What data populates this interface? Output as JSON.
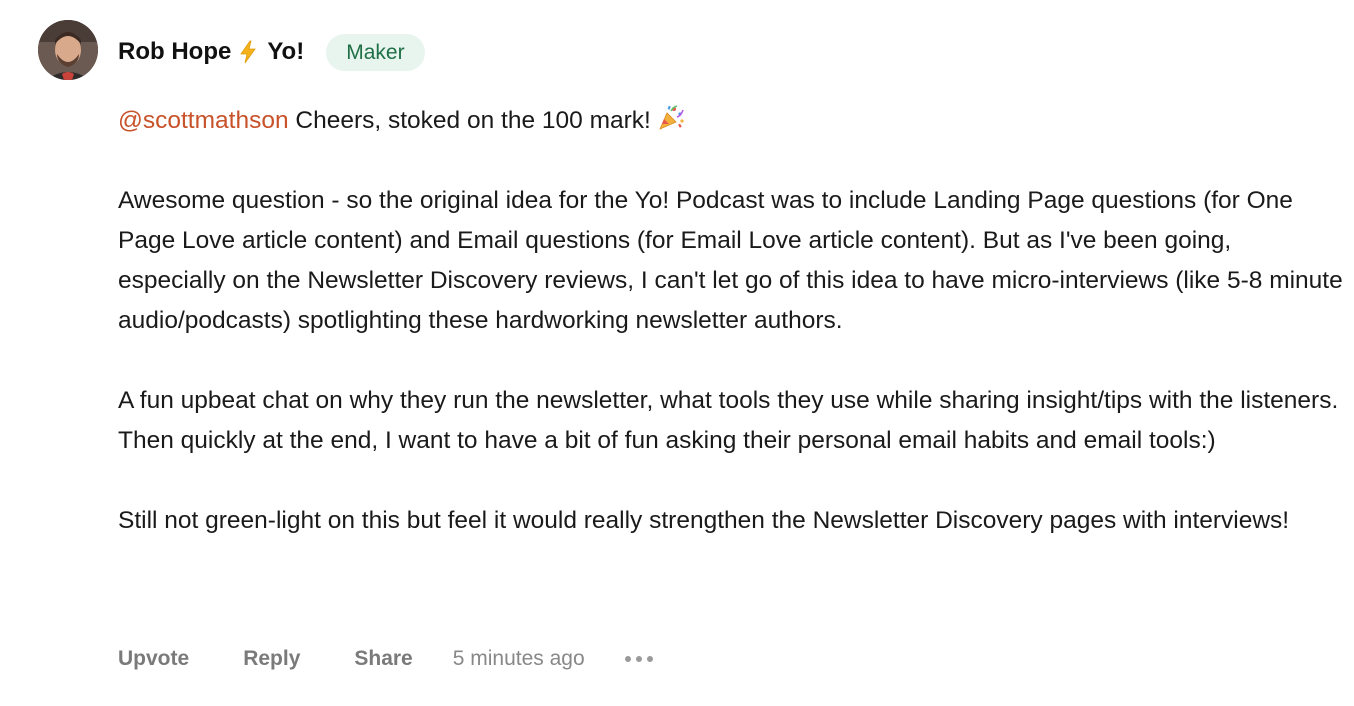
{
  "comment": {
    "author": {
      "name_part1": "Rob Hope",
      "bolt_icon": "lightning-bolt-icon",
      "name_part2": "Yo!",
      "badge": "Maker",
      "avatar_icon": "user-avatar"
    },
    "body": {
      "mention": "@scottmathson",
      "line1": " Cheers, stoked on the 100 mark!",
      "party_icon": "party-popper-icon",
      "paragraph2": "Awesome question - so the original idea for the Yo! Podcast was to include Landing Page questions (for One Page Love article content) and Email questions (for Email Love article content). But as I've been going, especially on the Newsletter Discovery reviews, I can't let go of this idea to have micro-interviews (like 5-8 minute audio/podcasts) spotlighting these hardworking newsletter authors.",
      "paragraph3": "A fun upbeat chat on why they run the newsletter, what tools they use while sharing insight/tips with the listeners. Then quickly at the end, I want to have a bit of fun asking their personal email habits and email tools:)",
      "paragraph4": "Still not green-light on this but feel it would really strengthen the Newsletter Discovery pages with interviews!"
    },
    "actions": {
      "upvote": "Upvote",
      "reply": "Reply",
      "share": "Share",
      "timestamp": "5 minutes ago",
      "more_icon": "more-options-icon"
    }
  },
  "colors": {
    "mention": "#c8522a",
    "badge_bg": "#e8f5ee",
    "badge_text": "#1f6f47",
    "action_text": "#7a7a7a"
  }
}
